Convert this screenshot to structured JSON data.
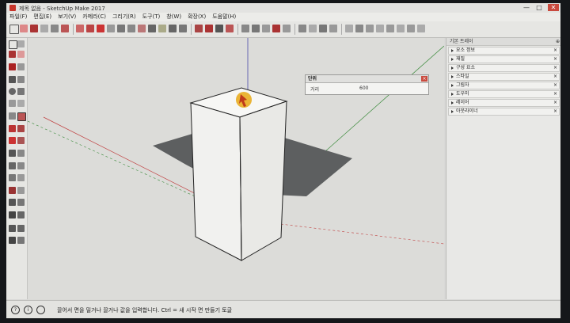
{
  "window": {
    "title": "제목 없음 - SketchUp Make 2017",
    "minimize": "—",
    "maximize": "□",
    "close": "✕"
  },
  "menu": [
    "파일(F)",
    "편집(E)",
    "보기(V)",
    "카메라(C)",
    "그리기(R)",
    "도구(T)",
    "창(W)",
    "확장(X)",
    "도움말(H)"
  ],
  "toolbar_icons": [
    "select-icon",
    "eraser-icon",
    "pencil-icon",
    "shape-icon",
    "paint-icon",
    "pushpull-icon",
    "move-icon",
    "rotate-icon",
    "scale-icon",
    "offset-icon",
    "tape-icon",
    "text-icon",
    "axes-icon",
    "orbit-icon",
    "pan-icon",
    "zoom-icon",
    "zoom-extents-icon",
    "warehouse-icon",
    "extension-icon",
    "layout-icon",
    "iso-icon",
    "top-icon",
    "front-icon",
    "right-icon",
    "back-icon",
    "left-icon",
    "xray-icon",
    "wire-icon",
    "hidden-icon",
    "shaded-icon",
    "textured-icon",
    "mono-icon"
  ],
  "measure_box": {
    "title": "단위",
    "label": "거리",
    "value": "600"
  },
  "tray": {
    "title": "기본 트레이",
    "pin": "⊕",
    "items": [
      "요소 정보",
      "재질",
      "구성 요소",
      "스타일",
      "그림자",
      "도우미",
      "레이어",
      "아웃라이너"
    ]
  },
  "status": {
    "text": "끌어서 면을 밀거나 끌거나 값을 입력합니다. Ctrl = 새 시작 면 만들기 토글",
    "icon1": "?",
    "icon2": "i"
  },
  "colors": {
    "box_face": "#f7f7f5",
    "shadow": "#5d5f60",
    "axis_red": "#c04040",
    "axis_green": "#3a8a3a",
    "axis_blue": "#4a4aa8",
    "cursor": "#e8a814"
  }
}
